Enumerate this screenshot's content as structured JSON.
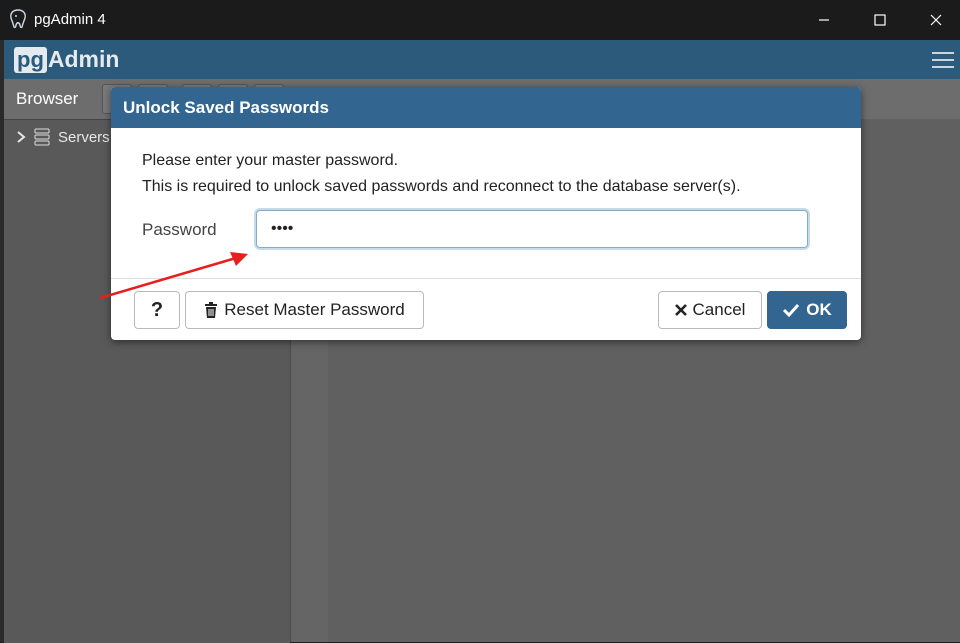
{
  "window": {
    "title": "pgAdmin 4"
  },
  "header": {
    "logo_pg": "pg",
    "logo_admin": "Admin"
  },
  "browser": {
    "label": "Browser",
    "tree_item": "Servers"
  },
  "dialog": {
    "title": "Unlock Saved Passwords",
    "message_line1": "Please enter your master password.",
    "message_line2": "This is required to unlock saved passwords and reconnect to the database server(s).",
    "password_label": "Password",
    "password_value": "••••",
    "help_label": "?",
    "reset_label": "Reset Master Password",
    "cancel_label": "Cancel",
    "ok_label": "OK"
  },
  "colors": {
    "accent": "#326690",
    "header": "#2c5a7a",
    "annotation_arrow": "#e5201e"
  },
  "icons": [
    "app-elephant-icon",
    "minimize-icon",
    "maximize-icon",
    "close-icon",
    "hamburger-menu-icon",
    "chevron-right-icon",
    "servers-icon",
    "trash-icon",
    "x-icon",
    "check-icon"
  ]
}
